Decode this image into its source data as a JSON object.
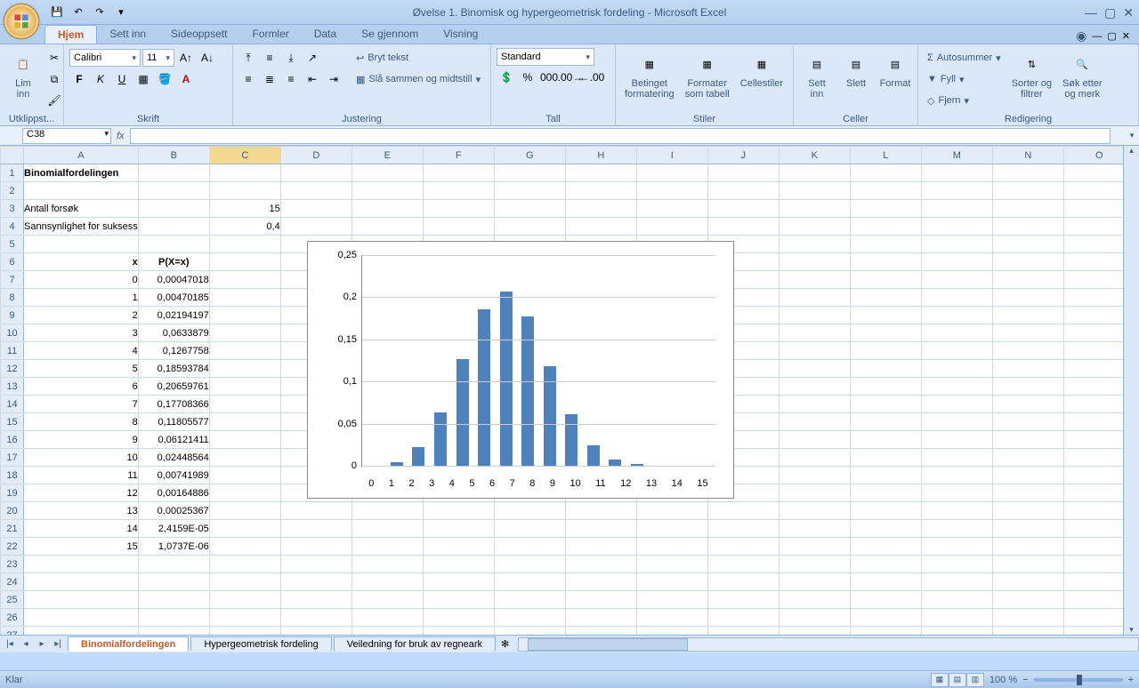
{
  "title": "Øvelse 1. Binomisk og hypergeometrisk fordeling - Microsoft Excel",
  "tabs": [
    "Hjem",
    "Sett inn",
    "Sideoppsett",
    "Formler",
    "Data",
    "Se gjennom",
    "Visning"
  ],
  "activeTab": "Hjem",
  "ribbon": {
    "clipboard": {
      "paste": "Lim\ninn",
      "label": "Utklippst..."
    },
    "font": {
      "name": "Calibri",
      "size": "11",
      "label": "Skrift"
    },
    "alignment": {
      "wrap": "Bryt tekst",
      "merge": "Slå sammen og midtstill",
      "label": "Justering"
    },
    "number": {
      "format": "Standard",
      "label": "Tall"
    },
    "styles": {
      "cond": "Betinget\nformatering",
      "table": "Formater\nsom tabell",
      "cell": "Cellestiler",
      "label": "Stiler"
    },
    "cells": {
      "insert": "Sett\ninn",
      "delete": "Slett",
      "format": "Format",
      "label": "Celler"
    },
    "editing": {
      "sum": "Autosummer",
      "fill": "Fyll",
      "clear": "Fjern",
      "sort": "Sorter og\nfiltrer",
      "find": "Søk etter\nog merk",
      "label": "Redigering"
    }
  },
  "nameBox": "C38",
  "formula": "",
  "columns": [
    "A",
    "B",
    "C",
    "D",
    "E",
    "F",
    "G",
    "H",
    "I",
    "J",
    "K",
    "L",
    "M",
    "N",
    "O"
  ],
  "rows": [
    1,
    2,
    3,
    4,
    5,
    6,
    7,
    8,
    9,
    10,
    11,
    12,
    13,
    14,
    15,
    16,
    17,
    18,
    19,
    20,
    21,
    22,
    23,
    24,
    25,
    26,
    27
  ],
  "cells": {
    "A1": "Binomialfordelingen",
    "A3": "Antall forsøk",
    "C3": "15",
    "A4": "Sannsynlighet for suksess",
    "C4": "0,4",
    "A6": "x",
    "B6": "P(X=x)",
    "A7": "0",
    "B7": "0,00047018",
    "A8": "1",
    "B8": "0,00470185",
    "A9": "2",
    "B9": "0,02194197",
    "A10": "3",
    "B10": "0,0633879",
    "A11": "4",
    "B11": "0,1267758",
    "A12": "5",
    "B12": "0,18593784",
    "A13": "6",
    "B13": "0,20659761",
    "A14": "7",
    "B14": "0,17708366",
    "A15": "8",
    "B15": "0,11805577",
    "A16": "9",
    "B16": "0,06121411",
    "A17": "10",
    "B17": "0,02448564",
    "A18": "11",
    "B18": "0,00741989",
    "A19": "12",
    "B19": "0,00164886",
    "A20": "13",
    "B20": "0,00025367",
    "A21": "14",
    "B21": "2,4159E-05",
    "A22": "15",
    "B22": "1,0737E-06"
  },
  "selectedCell": "C38",
  "selectedCol": "C",
  "chart_data": {
    "type": "bar",
    "categories": [
      0,
      1,
      2,
      3,
      4,
      5,
      6,
      7,
      8,
      9,
      10,
      11,
      12,
      13,
      14,
      15
    ],
    "values": [
      0.00047018,
      0.00470185,
      0.02194197,
      0.0633879,
      0.1267758,
      0.18593784,
      0.20659761,
      0.17708366,
      0.11805577,
      0.06121411,
      0.02448564,
      0.00741989,
      0.00164886,
      0.00025367,
      2.4159e-05,
      1.0737e-06
    ],
    "ylim": [
      0,
      0.25
    ],
    "yticks": [
      0,
      0.05,
      0.1,
      0.15,
      0.2,
      0.25
    ],
    "yticklabels": [
      "0",
      "0,05",
      "0,1",
      "0,15",
      "0,2",
      "0,25"
    ]
  },
  "sheetTabs": [
    "Binomialfordelingen",
    "Hypergeometrisk fordeling",
    "Veiledning for bruk av regneark"
  ],
  "activeSheet": "Binomialfordelingen",
  "status": "Klar",
  "zoom": "100 %"
}
